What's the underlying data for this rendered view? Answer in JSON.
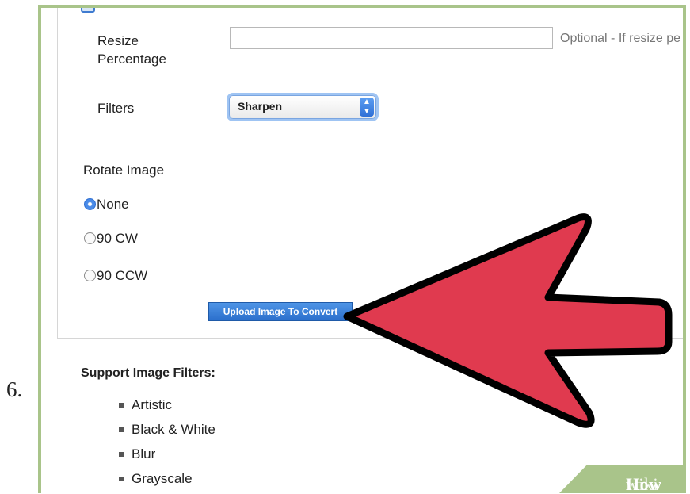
{
  "step": {
    "number": "6."
  },
  "form": {
    "resize_label": "Resize\nPercentage",
    "resize_input_value": "",
    "resize_hint": "Optional - If resize pe",
    "filters_label": "Filters",
    "filters_selected": "Sharpen",
    "rotate_label": "Rotate Image",
    "rotate_options": [
      {
        "label": "None",
        "checked": true
      },
      {
        "label": "90 CW",
        "checked": false
      },
      {
        "label": "90 CCW",
        "checked": false
      }
    ],
    "upload_button": "Upload Image To Convert"
  },
  "support": {
    "title": "Support Image Filters:",
    "filters": [
      "Artistic",
      "Black & White",
      "Blur",
      "Grayscale"
    ]
  },
  "annotation": {
    "arrow_color": "#e03a4f",
    "outline_color": "#000000"
  },
  "watermark": {
    "part1": "wiki",
    "part2": "How"
  },
  "colors": {
    "frame": "#a9c48a",
    "button": "#2b6fcc"
  }
}
